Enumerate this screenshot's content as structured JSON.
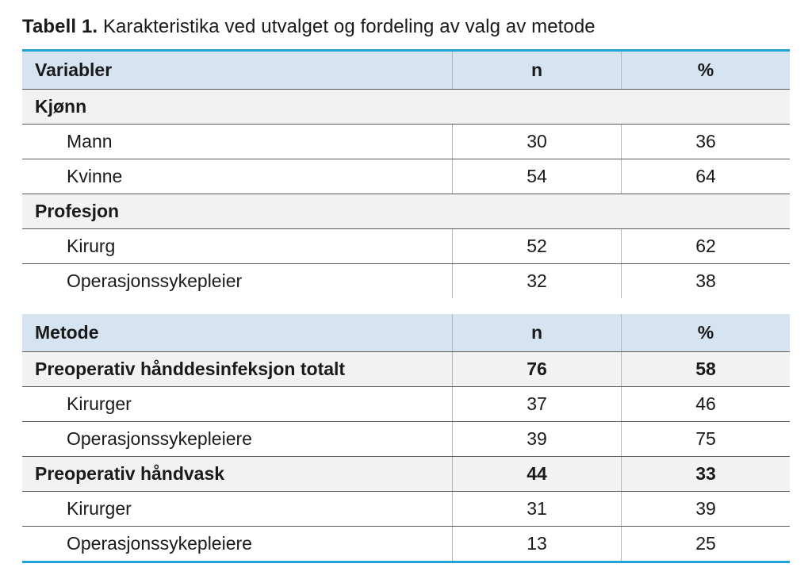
{
  "caption_label": "Tabell 1.",
  "caption_text": "Karakteristika ved utvalget og fordeling av valg av metode",
  "table1": {
    "headers": {
      "var": "Variabler",
      "n": "n",
      "pct": "%"
    },
    "sections": [
      {
        "title": "Kjønn",
        "rows": [
          {
            "label": "Mann",
            "n": "30",
            "pct": "36"
          },
          {
            "label": "Kvinne",
            "n": "54",
            "pct": "64"
          }
        ]
      },
      {
        "title": "Profesjon",
        "rows": [
          {
            "label": "Kirurg",
            "n": "52",
            "pct": "62"
          },
          {
            "label": "Operasjonssykepleier",
            "n": "32",
            "pct": "38"
          }
        ]
      }
    ]
  },
  "table2": {
    "headers": {
      "var": "Metode",
      "n": "n",
      "pct": "%"
    },
    "groups": [
      {
        "title": "Preoperativ hånddesinfeksjon totalt",
        "n": "76",
        "pct": "58",
        "rows": [
          {
            "label": "Kirurger",
            "n": "37",
            "pct": "46"
          },
          {
            "label": "Operasjonssykepleiere",
            "n": "39",
            "pct": "75"
          }
        ]
      },
      {
        "title": "Preoperativ håndvask",
        "n": "44",
        "pct": "33",
        "rows": [
          {
            "label": "Kirurger",
            "n": "31",
            "pct": "39"
          },
          {
            "label": "Operasjonssykepleiere",
            "n": "13",
            "pct": "25"
          }
        ]
      }
    ]
  },
  "chart_data": {
    "type": "table",
    "title": "Tabell 1. Karakteristika ved utvalget og fordeling av valg av metode",
    "tables": [
      {
        "columns": [
          "Variabler",
          "n",
          "%"
        ],
        "rows": [
          [
            "Kjønn",
            null,
            null
          ],
          [
            "Mann",
            30,
            36
          ],
          [
            "Kvinne",
            54,
            64
          ],
          [
            "Profesjon",
            null,
            null
          ],
          [
            "Kirurg",
            52,
            62
          ],
          [
            "Operasjonssykepleier",
            32,
            38
          ]
        ]
      },
      {
        "columns": [
          "Metode",
          "n",
          "%"
        ],
        "rows": [
          [
            "Preoperativ hånddesinfeksjon totalt",
            76,
            58
          ],
          [
            "Kirurger",
            37,
            46
          ],
          [
            "Operasjonssykepleiere",
            39,
            75
          ],
          [
            "Preoperativ håndvask",
            44,
            33
          ],
          [
            "Kirurger",
            31,
            39
          ],
          [
            "Operasjonssykepleiere",
            13,
            25
          ]
        ]
      }
    ]
  }
}
